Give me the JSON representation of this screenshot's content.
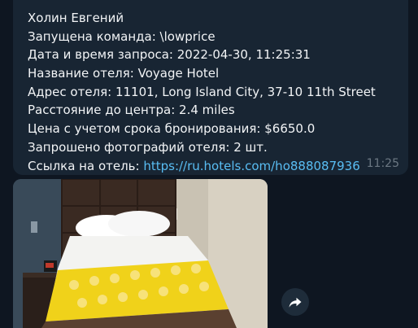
{
  "message": {
    "lines": [
      "Холин Евгений",
      "Запущена команда: \\lowprice",
      "Дата и время запроса: 2022-04-30, 11:25:31",
      "Название отеля: Voyage Hotel",
      "Адрес отеля: 11101, Long Island City, 37-10 11th Street",
      "Расстояние до центра: 2.4 miles",
      "Цена с учетом срока бронирования: $6650.0",
      "Запрошено фотографий отеля: 2 шт."
    ],
    "link_prefix": "Ссылка на отель: ",
    "link_url": "https://ru.hotels.com/ho888087936",
    "time": "11:25"
  },
  "photo": {
    "alt": "Hotel room photo"
  },
  "forward": {
    "icon": "forward-icon"
  },
  "colors": {
    "background": "#0e1621",
    "bubble": "#182533",
    "text": "#f2f4f6",
    "link": "#59bdf3",
    "time": "#6c7883"
  }
}
